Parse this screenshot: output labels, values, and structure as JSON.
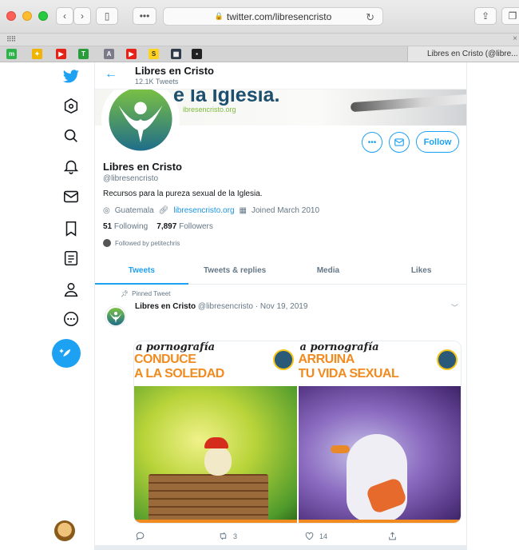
{
  "browser": {
    "url": "twitter.com/libresencristo",
    "tab_title": "Libres en Cristo (@libre..."
  },
  "header": {
    "name": "Libres en Cristo",
    "tweet_count": "12.1K Tweets"
  },
  "banner": {
    "title": "e la Iglesia.",
    "url": "ibresencristo.org"
  },
  "profile": {
    "name": "Libres en Cristo",
    "handle": "@libresencristo",
    "bio": "Recursos para la pureza sexual de la Iglesia.",
    "location": "Guatemala",
    "website": "libresencristo.org",
    "joined": "Joined March 2010",
    "following_count": "51",
    "following_label": "Following",
    "followers_count": "7,897",
    "followers_label": "Followers",
    "followed_by": "Followed by petitechris",
    "follow_label": "Follow"
  },
  "tabs": [
    "Tweets",
    "Tweets & replies",
    "Media",
    "Likes"
  ],
  "tweet": {
    "pinned_label": "Pinned Tweet",
    "author": "Libres en Cristo",
    "handle": "@libresencristo",
    "date": "Nov 19, 2019",
    "images": [
      {
        "line1": "a pornografía",
        "line2": "CONDUCE",
        "line3": "A LA SOLEDAD"
      },
      {
        "line1": "a pornografía",
        "line2": "ARRUINA",
        "line3": "TU VIDA SEXUAL"
      }
    ],
    "retweets": "3",
    "likes": "14"
  },
  "colors": {
    "twitter_blue": "#1da1f2",
    "accent_orange": "#f28b1f"
  }
}
